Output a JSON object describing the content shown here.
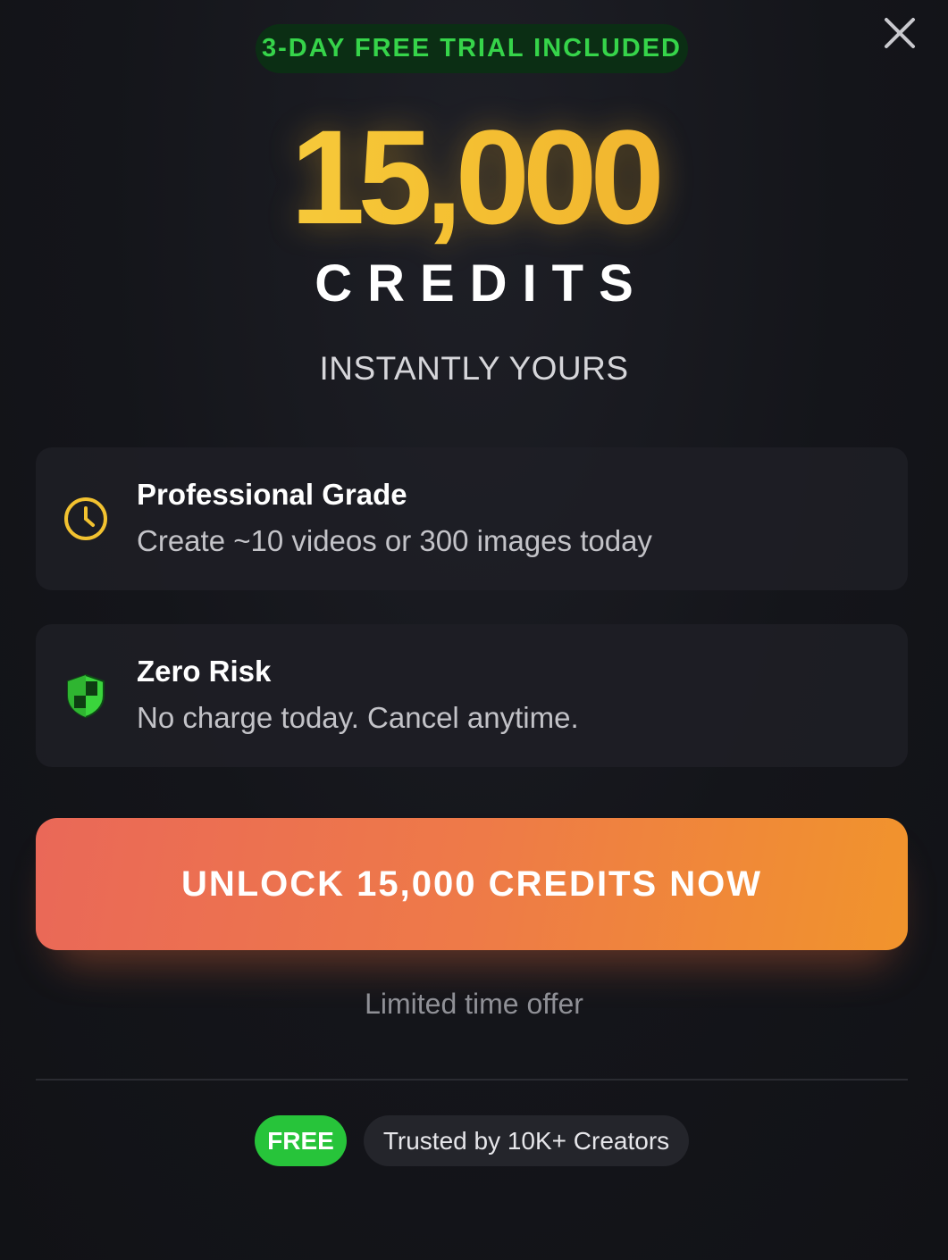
{
  "trial_badge": {
    "text": "3-DAY FREE TRIAL INCLUDED"
  },
  "close_icon": "close-x-icon",
  "hero": {
    "amount": "15,000",
    "unit": "CREDITS",
    "subtitle": "INSTANTLY YOURS"
  },
  "features": [
    {
      "icon": "clock-icon",
      "title": "Professional Grade",
      "description": "Create ~10 videos or 300 images today"
    },
    {
      "icon": "shield-icon",
      "title": "Zero Risk",
      "description": "No charge today. Cancel anytime."
    }
  ],
  "cta": {
    "label": "UNLOCK 15,000 CREDITS NOW"
  },
  "offer_note": "Limited time offer",
  "footer": {
    "free_badge": "FREE",
    "trust_text": "Trusted by 10K+ Creators"
  },
  "colors": {
    "background": "#14151a",
    "accent_gold": "#f5c233",
    "accent_green": "#27c43a",
    "cta_start": "#ea6858",
    "cta_end": "#f1942c",
    "badge_bg": "#0b2e14",
    "badge_text": "#36d44a",
    "clock_icon": "#f2c230",
    "shield_icon": "#3ad43c"
  }
}
